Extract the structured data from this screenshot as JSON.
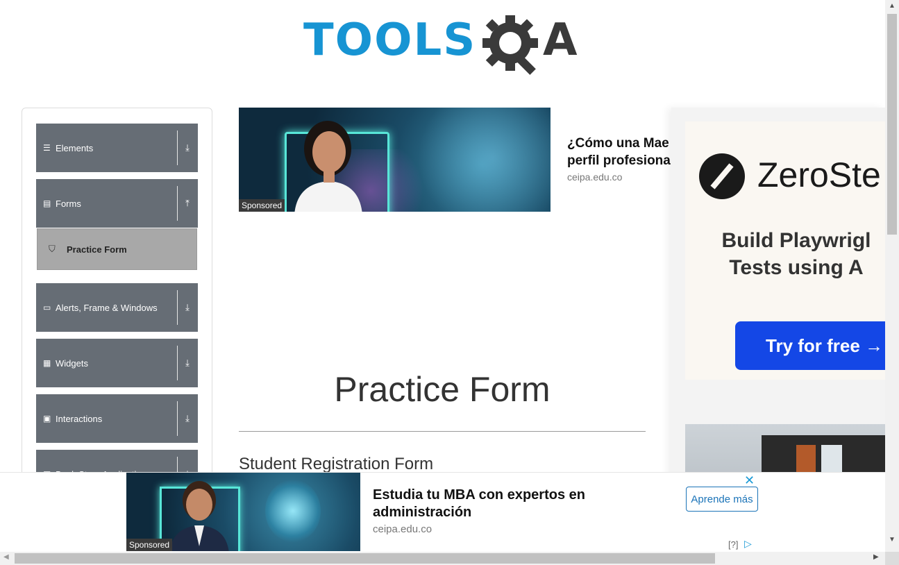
{
  "logo": {
    "text_tools": "TOOLS",
    "text_a": "A",
    "alt": "TOOLSQA"
  },
  "sidebar": {
    "groups": [
      {
        "label": "Elements",
        "icon": "list-icon",
        "glyph": "☰",
        "arrow": "⤓"
      },
      {
        "label": "Forms",
        "icon": "document-icon",
        "glyph": "▤",
        "arrow": "⤒"
      },
      {
        "label": "Alerts, Frame & Windows",
        "icon": "window-icon",
        "glyph": "▭",
        "arrow": "⤓"
      },
      {
        "label": "Widgets",
        "icon": "grid-icon",
        "glyph": "▦",
        "arrow": "⤓"
      },
      {
        "label": "Interactions",
        "icon": "interaction-icon",
        "glyph": "▣",
        "arrow": "⤓"
      },
      {
        "label": "Book Store Application",
        "icon": "books-icon",
        "glyph": "▥",
        "arrow": "⤓"
      }
    ],
    "active_item": {
      "label": "Practice Form",
      "icon": "html5-icon",
      "glyph": "⛉"
    }
  },
  "ad_top": {
    "title": "¿Cómo una Mae perfil profesiona",
    "title_line1": "¿Cómo una Mae",
    "title_line2": "perfil profesiona",
    "domain": "ceipa.edu.co",
    "sponsored": "Sponsored"
  },
  "ad_right": {
    "brand": "ZeroSte",
    "tagline_line1": "Build Playwrigl",
    "tagline_line2": "Tests using A",
    "cta": "Try for free →"
  },
  "main": {
    "page_title": "Practice Form",
    "form_heading": "Student Registration Form"
  },
  "ad_bottom": {
    "title_line1": "Estudia tu MBA con expertos en",
    "title_line2": "administración",
    "domain": "ceipa.edu.co",
    "sponsored": "Sponsored",
    "cta": "Aprende más",
    "close": "✕",
    "info": "[?]",
    "adchoices": "▷"
  },
  "colors": {
    "sidebar_group_bg": "#666d75",
    "active_item_bg": "#a8a8a8",
    "brand_blue": "#1794d3",
    "zerostep_button": "#1447e6"
  }
}
